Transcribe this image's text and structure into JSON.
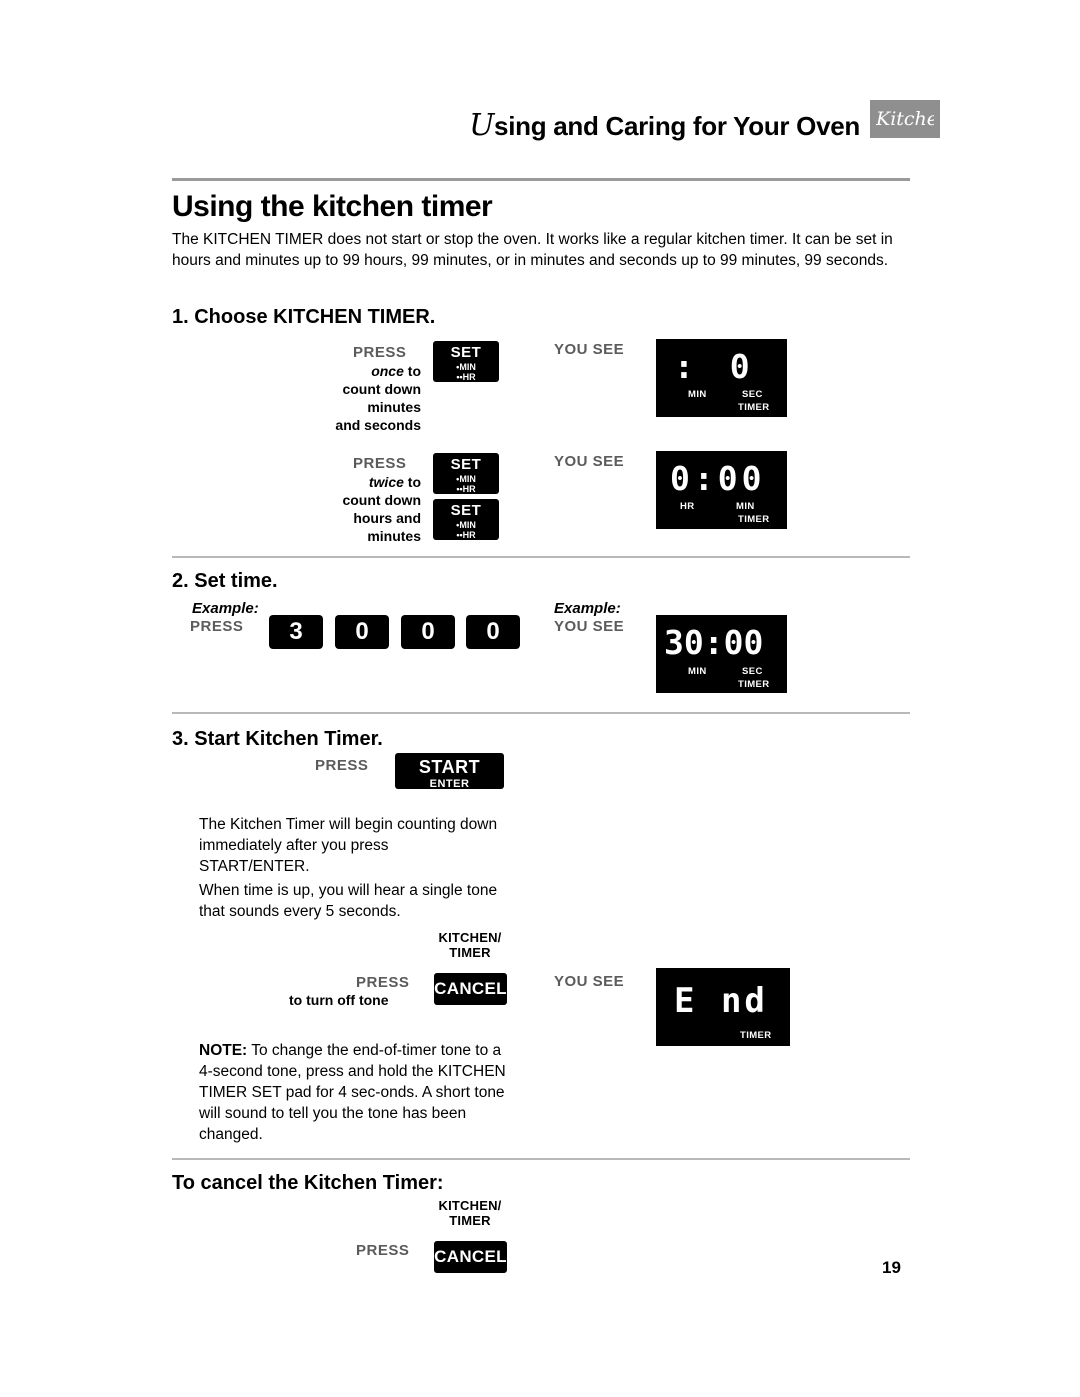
{
  "header": {
    "title_lead": "U",
    "title_rest": "sing and Caring for Your Oven",
    "logo_signature": "KitchenAid"
  },
  "page_number": "19",
  "section": {
    "title": "Using the kitchen timer",
    "intro": "The KITCHEN TIMER does not start or stop the oven. It works like a regular kitchen timer. It can be set in hours and minutes up to 99 hours, 99 minutes, or in minutes and seconds up to 99 minutes, 99 seconds."
  },
  "step1": {
    "heading": "1. Choose KITCHEN TIMER.",
    "row1": {
      "press_label": "PRESS",
      "instruction_em": "once",
      "instruction_rest": " to",
      "instruction_line2": "count down",
      "instruction_line3": "minutes",
      "instruction_line4": "and seconds",
      "button": {
        "main": "SET",
        "sub1": "•MIN",
        "sub2": "••HR"
      },
      "yousee_label": "YOU SEE",
      "display": {
        "digits": ": 0",
        "left_unit": "MIN",
        "right_unit": "SEC",
        "timer": "TIMER"
      }
    },
    "row2": {
      "press_label": "PRESS",
      "instruction_em": "twice",
      "instruction_rest": " to",
      "instruction_line2": "count down",
      "instruction_line3": "hours and",
      "instruction_line4": "minutes",
      "button1": {
        "main": "SET",
        "sub1": "•MIN",
        "sub2": "••HR"
      },
      "button2": {
        "main": "SET",
        "sub1": "•MIN",
        "sub2": "••HR"
      },
      "yousee_label": "YOU SEE",
      "display": {
        "digits": "0:00",
        "left_unit": "HR",
        "right_unit": "MIN",
        "timer": "TIMER"
      }
    }
  },
  "step2": {
    "heading": "2. Set time.",
    "example_label_left": "Example:",
    "press_label": "PRESS",
    "keys": [
      "3",
      "0",
      "0",
      "0"
    ],
    "example_label_right": "Example:",
    "yousee_label": "YOU SEE",
    "display": {
      "digits": "30:00",
      "left_unit": "MIN",
      "right_unit": "SEC",
      "timer": "TIMER"
    }
  },
  "step3": {
    "heading": "3. Start Kitchen Timer.",
    "press_label": "PRESS",
    "start_button": {
      "main": "START",
      "sub": "ENTER"
    },
    "paragraph1": "The Kitchen Timer will begin counting down immediately after you press START/ENTER.",
    "paragraph2": "When time is up, you will hear a single tone that sounds every 5 seconds.",
    "cancel_group": {
      "kitchen_label_line1": "KITCHEN/",
      "kitchen_label_line2": "TIMER",
      "press_label": "PRESS",
      "instruction": "to turn off tone",
      "cancel_button": "CANCEL",
      "yousee_label": "YOU SEE",
      "display": {
        "digits": "E nd",
        "timer": "TIMER"
      }
    },
    "note_bold": "NOTE:",
    "note_text": " To change the end-of-timer tone to a 4-second tone, press and hold the KITCHEN TIMER SET pad for 4 sec-onds. A short tone will sound to tell you the tone has been changed."
  },
  "cancel_section": {
    "heading": "To cancel the Kitchen Timer:",
    "kitchen_label_line1": "KITCHEN/",
    "kitchen_label_line2": "TIMER",
    "press_label": "PRESS",
    "cancel_button": "CANCEL"
  }
}
